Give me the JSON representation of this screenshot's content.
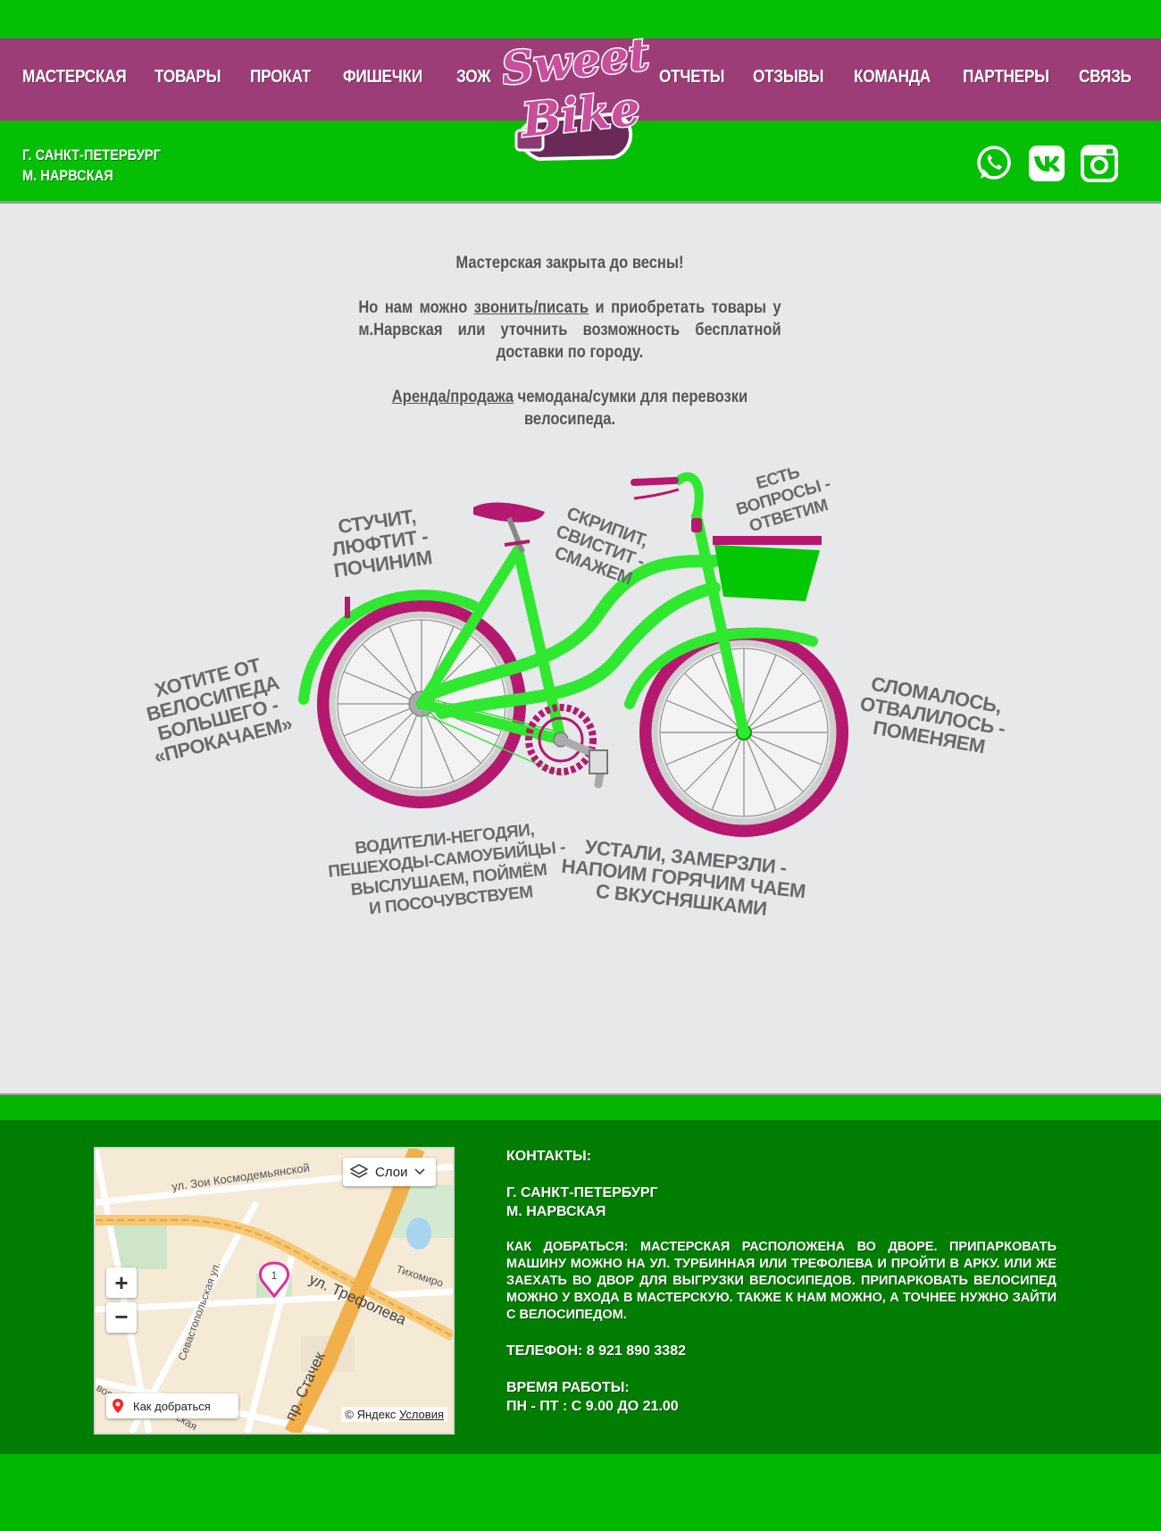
{
  "header": {
    "nav_left": [
      "МАСТЕРСКАЯ",
      "ТОВАРЫ",
      "ПРОКАТ",
      "ФИШЕЧКИ",
      "ЗОЖ"
    ],
    "nav_right": [
      "ОТЧЕТЫ",
      "ОТЗЫВЫ",
      "КОМАНДА",
      "ПАРТНЕРЫ",
      "СВЯЗЬ"
    ],
    "logo_text": "Sweet Bike",
    "city": "Г. САНКТ-ПЕТЕРБУРГ",
    "metro": "М. НАРВСКАЯ",
    "social_icons": [
      "whatsapp-icon",
      "vk-icon",
      "instagram-icon"
    ]
  },
  "notice": {
    "line1": "Мастерская закрыта до весны!",
    "line2_before": "Но нам можно ",
    "line2_link": "звонить/писать",
    "line2_after": " и приобретать товары у м.Нарвская или уточнить возможность бесплатной доставки по городу.",
    "line3_link": "Аренда/продажа",
    "line3_after": " чемодана/сумки для перевозки велосипеда."
  },
  "bike_labels": {
    "knock": "СТУЧИТ,\nЛЮФТИТ -\nПОЧИНИМ",
    "squeak": "СКРИПИТ,\nСВИСТИТ -\nСМАЖЕМ",
    "questions": "ЕСТЬ\nВОПРОСЫ -\nОТВЕТИМ",
    "pump": "ХОТИТЕ ОТ\nВЕЛОСИПЕДА\nБОЛЬШЕГО -\n«ПРОКАЧАЕМ»",
    "broken": "СЛОМАЛОСЬ,\nОТВАЛИЛОСЬ -\nПОМЕНЯЕМ",
    "drivers": "ВОДИТЕЛИ-НЕГОДЯИ,\nПЕШЕХОДЫ-САМОУБИЙЦЫ -\nВЫСЛУШАЕМ, ПОЙМЁМ\nИ ПОСОЧУВСТВУЕМ",
    "tired": "УСТАЛИ, ЗАМЕРЗЛИ -\nНАПОИМ ГОРЯЧИМ ЧАЕМ\nС ВКУСНЯШКАМИ"
  },
  "map": {
    "layers_label": "Слои",
    "zoom_in": "+",
    "zoom_out": "−",
    "route_label": "Как добраться",
    "copyright": "© Яндекс",
    "terms": "Условия",
    "marker_number": "1",
    "streets": {
      "kosmodemyanskoy": "ул. Зои Космодемьянской",
      "trefoleva": "ул. Трефолева",
      "sevastopolskaya": "Севастопольская ул.",
      "stachek": "пр. Стачек",
      "tikhomirov": "Тихомиро",
      "other": "вово",
      "other2": "вская"
    }
  },
  "contacts": {
    "heading": "КОНТАКТЫ:",
    "city": "Г. САНКТ-ПЕТЕРБУРГ",
    "metro": "М. НАРВСКАЯ",
    "directions": "КАК ДОБРАТЬСЯ: МАСТЕРСКАЯ РАСПОЛОЖЕНА ВО ДВОРЕ. ПРИПАРКОВАТЬ МАШИНУ МОЖНО НА УЛ. ТУРБИННАЯ ИЛИ ТРЕФОЛЕВА И ПРОЙТИ В АРКУ. ИЛИ ЖЕ ЗАЕХАТЬ ВО ДВОР ДЛЯ ВЫГРУЗКИ ВЕЛОСИПЕДОВ. ПРИПАРКОВАТЬ ВЕЛОСИПЕД МОЖНО У ВХОДА В МАСТЕРСКУЮ. ТАКЖЕ К НАМ МОЖНО, А ТОЧНЕЕ НУЖНО ЗАЙТИ С ВЕЛОСИПЕДОМ.",
    "phone": "ТЕЛЕФОН: 8 921 890 3382",
    "hours_heading": "ВРЕМЯ РАБОТЫ:",
    "hours": "ПН  - ПТ :  С 9.00 ДО 21.00"
  },
  "colors": {
    "green": "#04bf04",
    "dark_green": "#017e01",
    "magenta": "#9d3d78",
    "bike_green": "#2fe82f",
    "bike_magenta": "#b5186f",
    "text_gray": "#555555"
  }
}
